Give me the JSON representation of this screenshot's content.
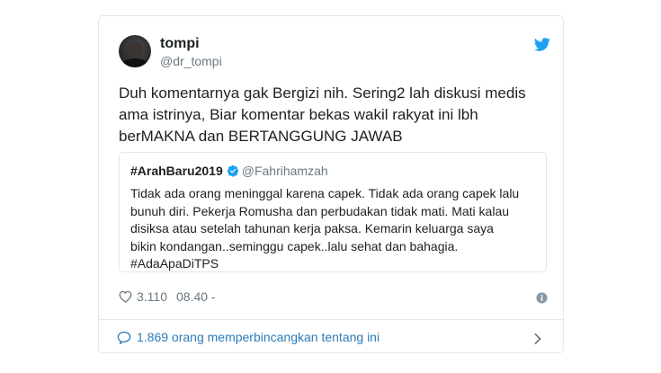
{
  "author": {
    "name": "tompi",
    "handle": "@dr_tompi"
  },
  "tweet": {
    "lines": [
      "Duh komentarnya gak Bergizi nih. Sering2 lah diskusi medis",
      "ama istrinya, Biar komentar bekas wakil rakyat ini lbh",
      "berMAKNA dan BERTANGGUNG JAWAB"
    ]
  },
  "quoted": {
    "name": "#ArahBaru2019",
    "handle": "@Fahrihamzah",
    "lines": [
      "Tidak ada orang meninggal karena capek. Tidak ada orang capek lalu",
      "bunuh diri. Pekerja Romusha dan perbudakan tidak mati. Mati kalau",
      "disiksa atau setelah tahunan kerja paksa. Kemarin keluarga saya",
      "bikin kondangan..seminggu capek..lalu sehat dan bahagia.",
      "#AdaApaDiTPS"
    ]
  },
  "meta": {
    "likes": "3.110",
    "time": "08.40 -"
  },
  "footer": {
    "conversation": "1.869 orang memperbincangkan tentang ini"
  },
  "icons": {
    "brand": "twitter-bird-icon",
    "verified": "verified-badge-icon",
    "like": "heart-icon",
    "info": "info-icon",
    "reply": "reply-bubble-icon",
    "chevron": "chevron-right-icon"
  },
  "colors": {
    "brand_blue": "#1da1f2",
    "link_blue": "#2b7bb9",
    "secondary_text": "#697882",
    "border": "#e1e8ed"
  }
}
